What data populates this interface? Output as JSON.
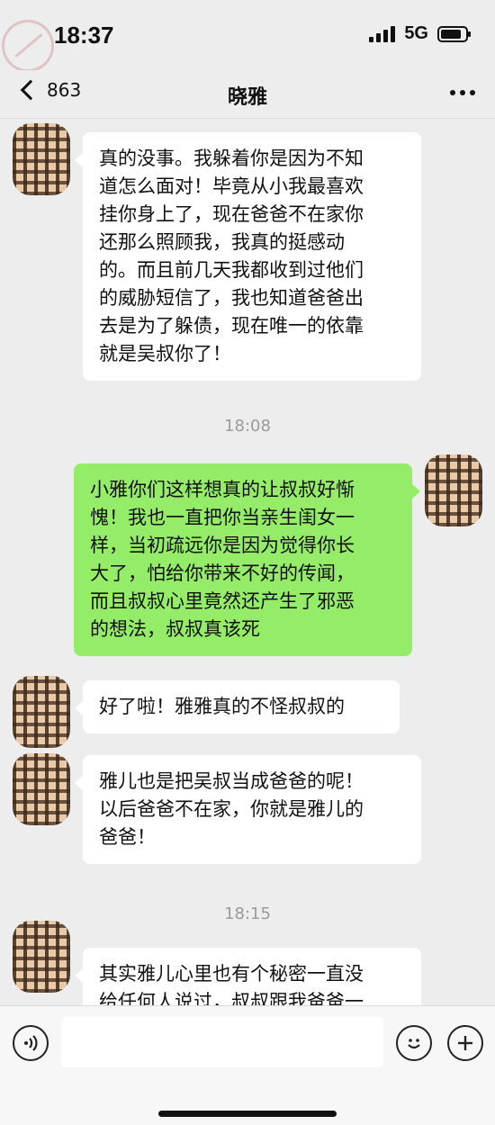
{
  "status_bar": {
    "time": "18:37",
    "network": "5G",
    "signal_icon": "signal-bars-icon",
    "battery_icon": "battery-icon",
    "battery_level": 0.85
  },
  "nav": {
    "back_count": "863",
    "title": "晓雅",
    "back_icon": "chevron-left-icon",
    "more_icon": "ellipsis-icon"
  },
  "messages": [
    {
      "type": "incoming",
      "text": "真的没事。我躲着你是因为不知\n道怎么面对！毕竟从小我最喜欢\n挂你身上了，现在爸爸不在家你\n还那么照顾我，我真的挺感动\n的。而且前几天我都收到过他们\n的威胁短信了，我也知道爸爸出\n去是为了躲债，现在唯一的依靠\n就是吴叔你了！"
    },
    {
      "type": "timestamp",
      "text": "18:08"
    },
    {
      "type": "outgoing",
      "text": "小雅你们这样想真的让叔叔好惭\n愧！我也一直把你当亲生闺女一\n样，当初疏远你是因为觉得你长\n大了，怕给你带来不好的传闻，\n而且叔叔心里竟然还产生了邪恶\n的想法，叔叔真该死"
    },
    {
      "type": "incoming",
      "text": "好了啦！雅雅真的不怪叔叔的"
    },
    {
      "type": "incoming",
      "text": "雅儿也是把吴叔当成爸爸的呢！\n以后爸爸不在家，你就是雅儿的\n爸爸！"
    },
    {
      "type": "timestamp",
      "text": "18:15"
    },
    {
      "type": "incoming",
      "text": "其实雅儿心里也有个秘密一直没\n给任何人说过，叔叔跟我爸爸一"
    }
  ],
  "input_bar": {
    "voice_icon": "voice-icon",
    "emoji_icon": "emoji-smile-icon",
    "plus_icon": "plus-icon"
  },
  "colors": {
    "background": "#ededed",
    "incoming_bubble": "#ffffff",
    "outgoing_bubble": "#95ec69",
    "timestamp_text": "#9a9a9a"
  }
}
